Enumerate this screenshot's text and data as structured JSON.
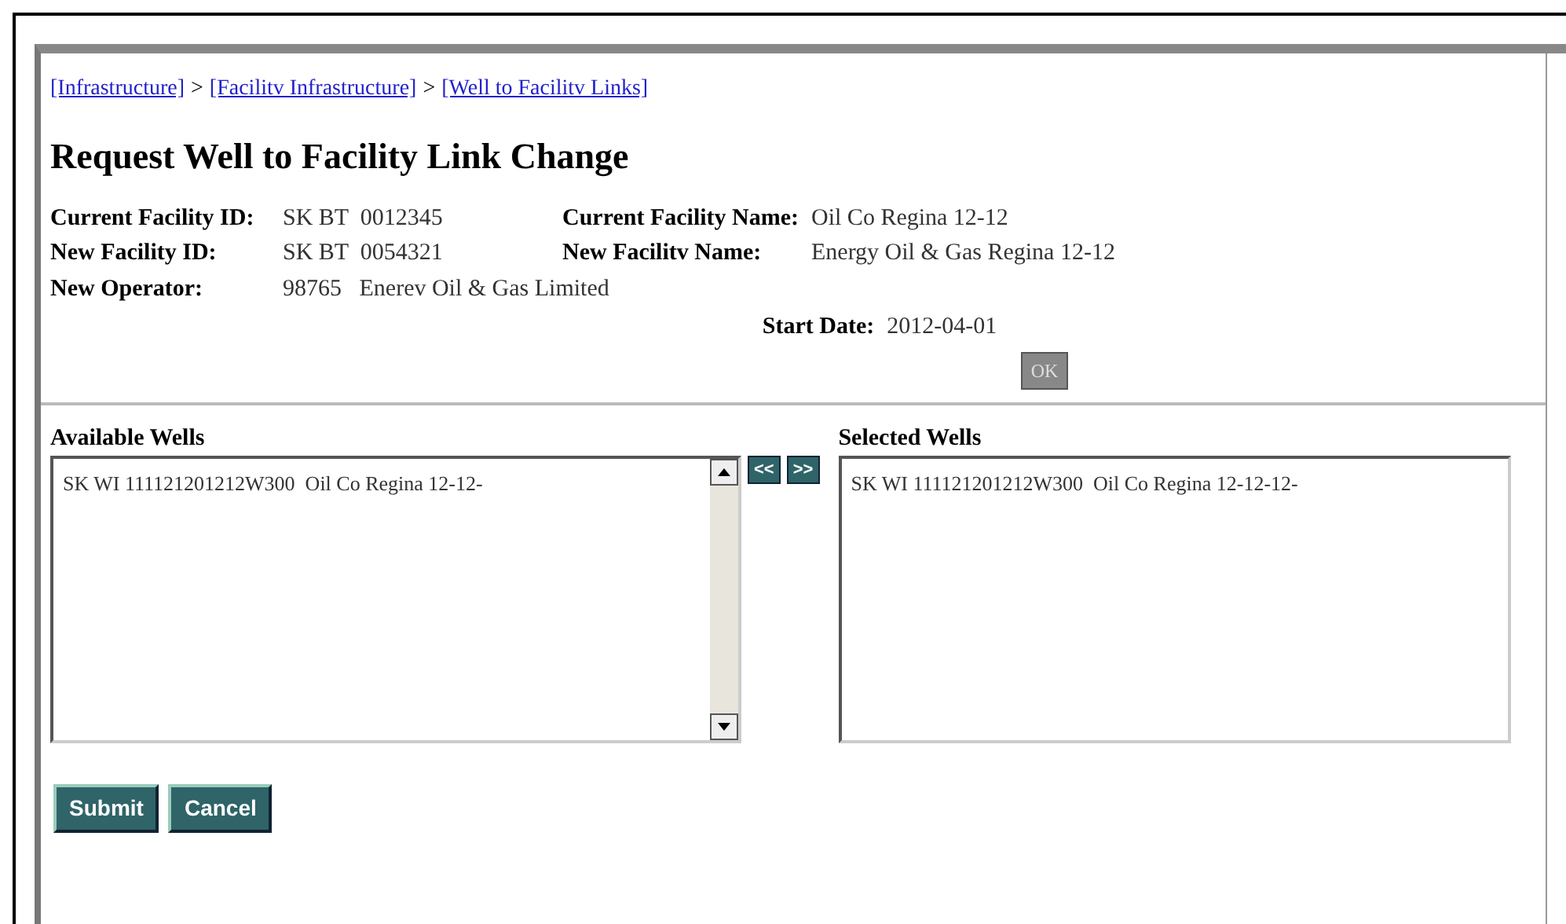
{
  "breadcrumbs": [
    "[Infrastructure]",
    "[Facilitv Infrastructure]",
    "[Well to Facilitv Links]"
  ],
  "breadcrumb_separator": ">",
  "title": "Request Well to Facility Link Change",
  "fields": [
    {
      "label": "Current Facility ID:",
      "value": "SK BT  0012345"
    },
    {
      "label": "Current Facility Name:",
      "value": "Oil Co Regina 12-12"
    },
    {
      "label": "New Facility ID:",
      "value": "SK BT  0054321"
    },
    {
      "label": "New Facilitv Name:",
      "value": "Energy Oil & Gas Regina 12-12"
    },
    {
      "label": "New Operator:",
      "value": "98765   Enerev Oil & Gas Limited"
    },
    {
      "label": "Start Date:",
      "value": "2012-04-01"
    }
  ],
  "ok_button": "OK",
  "available": {
    "label": "Available Wells",
    "items": [
      "SK WI 111121201212W300  Oil Co Regina 12-12-"
    ]
  },
  "move_buttons": [
    "<<",
    ">>"
  ],
  "selected": {
    "label": "Selected Wells",
    "items": [
      "SK WI 111121201212W300  Oil Co Regina 12-12-12-"
    ]
  },
  "buttons": [
    "Submit",
    "Cancel"
  ]
}
